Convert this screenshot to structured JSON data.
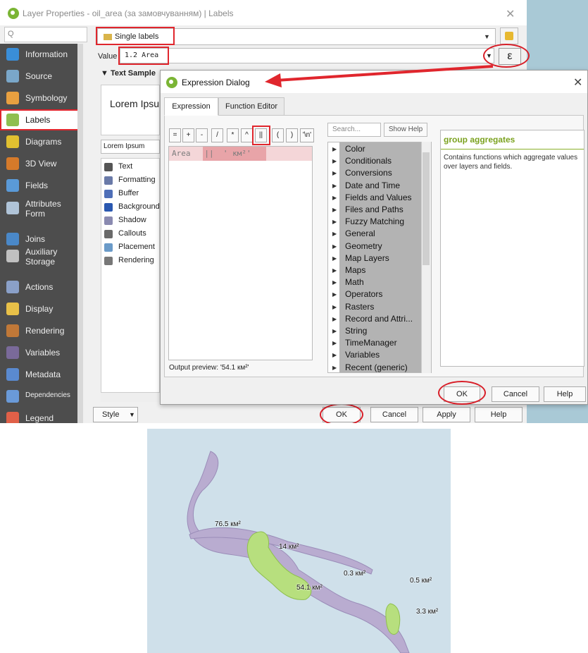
{
  "layer_properties": {
    "title": "Layer Properties - oil_area (за замовчуванням) | Labels",
    "search_placeholder": "Q",
    "sidebar": [
      {
        "label": "Information",
        "icon": "info-icon"
      },
      {
        "label": "Source",
        "icon": "source-icon"
      },
      {
        "label": "Symbology",
        "icon": "symbology-icon"
      },
      {
        "label": "Labels",
        "icon": "labels-icon",
        "active": true
      },
      {
        "label": "Diagrams",
        "icon": "diagrams-icon"
      },
      {
        "label": "3D View",
        "icon": "cube-icon"
      },
      {
        "label": "Fields",
        "icon": "fields-icon"
      },
      {
        "label": "Attributes Form",
        "icon": "form-icon"
      },
      {
        "label": "Joins",
        "icon": "joins-icon"
      },
      {
        "label": "Auxiliary Storage",
        "icon": "storage-icon"
      },
      {
        "label": "Actions",
        "icon": "actions-icon"
      },
      {
        "label": "Display",
        "icon": "display-icon"
      },
      {
        "label": "Rendering",
        "icon": "rendering-icon"
      },
      {
        "label": "Variables",
        "icon": "variables-icon"
      },
      {
        "label": "Metadata",
        "icon": "metadata-icon"
      },
      {
        "label": "Dependencies",
        "icon": "dependencies-icon"
      },
      {
        "label": "Legend",
        "icon": "legend-icon"
      }
    ],
    "label_mode": "Single labels",
    "value_label": "Value",
    "value_expression": "1.2 Area",
    "epsilon_symbol": "ε",
    "text_sample_header": "Text Sample",
    "sample_preview": "Lorem Ipsum",
    "sample_input": "Lorem Ipsum",
    "subtabs": [
      {
        "label": "Text",
        "icon": "text-icon"
      },
      {
        "label": "Formatting",
        "icon": "formatting-icon"
      },
      {
        "label": "Buffer",
        "icon": "buffer-icon"
      },
      {
        "label": "Background",
        "icon": "background-icon"
      },
      {
        "label": "Shadow",
        "icon": "shadow-icon"
      },
      {
        "label": "Callouts",
        "icon": "callouts-icon"
      },
      {
        "label": "Placement",
        "icon": "placement-icon"
      },
      {
        "label": "Rendering",
        "icon": "rendering-icon"
      }
    ],
    "buttons": {
      "style": "Style",
      "ok": "OK",
      "cancel": "Cancel",
      "apply": "Apply",
      "help": "Help"
    }
  },
  "expression_dialog": {
    "title": "Expression Dialog",
    "tabs": [
      "Expression",
      "Function Editor"
    ],
    "operators": [
      "=",
      "+",
      "-",
      "/",
      "*",
      "^",
      "||",
      "(",
      ")",
      "'\\n'"
    ],
    "expression_parts": {
      "field": "Area",
      "op": "||",
      "literal": "' км²'"
    },
    "output_preview": "Output preview:  '54.1 км²'",
    "search_placeholder": "Search...",
    "show_help": "Show Help",
    "functions": [
      "Color",
      "Conditionals",
      "Conversions",
      "Date and Time",
      "Fields and Values",
      "Files and Paths",
      "Fuzzy Matching",
      "General",
      "Geometry",
      "Map Layers",
      "Maps",
      "Math",
      "Operators",
      "Rasters",
      "Record and Attri...",
      "String",
      "TimeManager",
      "Variables",
      "Recent (generic)"
    ],
    "help_title": "group aggregates",
    "help_text": "Contains functions which aggregate values over layers and fields.",
    "buttons": {
      "ok": "OK",
      "cancel": "Cancel",
      "help": "Help"
    }
  },
  "map": {
    "labels": [
      "76.5 км²",
      "14 км²",
      "0.3 км²",
      "0.5 км²",
      "54.1 км²",
      "3.3 км²"
    ],
    "colors": {
      "water": "#cfe0ea",
      "river": "#b9acd0",
      "oil_area": "#b7df7e"
    }
  },
  "colors": {
    "highlight": "#e0262d",
    "sidebar": "#4d4d4d",
    "accent_green": "#7ba21f"
  }
}
